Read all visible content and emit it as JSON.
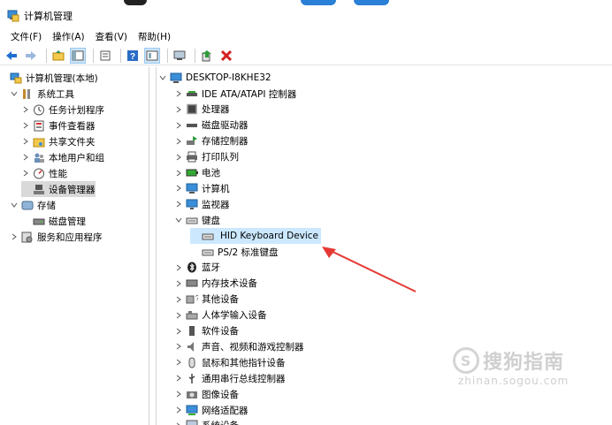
{
  "window": {
    "title": "计算机管理"
  },
  "menubar": [
    "文件(F)",
    "操作(A)",
    "查看(V)",
    "帮助(H)"
  ],
  "left_tree": [
    {
      "label": "计算机管理(本地)",
      "chev": "",
      "icon": "computer-management-icon",
      "level": 0
    },
    {
      "label": "系统工具",
      "chev": "v",
      "icon": "tools-icon",
      "level": 1
    },
    {
      "label": "任务计划程序",
      "chev": ">",
      "icon": "clock-icon",
      "level": 2
    },
    {
      "label": "事件查看器",
      "chev": ">",
      "icon": "event-viewer-icon",
      "level": 2
    },
    {
      "label": "共享文件夹",
      "chev": ">",
      "icon": "shared-folder-icon",
      "level": 2
    },
    {
      "label": "本地用户和组",
      "chev": ">",
      "icon": "users-icon",
      "level": 2
    },
    {
      "label": "性能",
      "chev": ">",
      "icon": "performance-icon",
      "level": 2
    },
    {
      "label": "设备管理器",
      "chev": "",
      "icon": "device-manager-icon",
      "level": 2,
      "selected": true
    },
    {
      "label": "存储",
      "chev": "v",
      "icon": "storage-icon",
      "level": 1
    },
    {
      "label": "磁盘管理",
      "chev": "",
      "icon": "disk-management-icon",
      "level": 2
    },
    {
      "label": "服务和应用程序",
      "chev": ">",
      "icon": "services-icon",
      "level": 1
    }
  ],
  "right_tree": {
    "root": "DESKTOP-I8KHE32",
    "items": [
      {
        "label": "IDE ATA/ATAPI 控制器",
        "chev": ">",
        "icon": "ide-controller-icon",
        "level": 1
      },
      {
        "label": "处理器",
        "chev": ">",
        "icon": "processor-icon",
        "level": 1
      },
      {
        "label": "磁盘驱动器",
        "chev": ">",
        "icon": "disk-drive-icon",
        "level": 1
      },
      {
        "label": "存储控制器",
        "chev": ">",
        "icon": "storage-controller-icon",
        "level": 1
      },
      {
        "label": "打印队列",
        "chev": ">",
        "icon": "printer-icon",
        "level": 1
      },
      {
        "label": "电池",
        "chev": ">",
        "icon": "battery-icon",
        "level": 1
      },
      {
        "label": "计算机",
        "chev": ">",
        "icon": "computer-icon",
        "level": 1
      },
      {
        "label": "监视器",
        "chev": ">",
        "icon": "monitor-icon",
        "level": 1
      },
      {
        "label": "键盘",
        "chev": "v",
        "icon": "keyboard-icon",
        "level": 1
      },
      {
        "label": "HID Keyboard Device",
        "chev": "",
        "icon": "keyboard-icon",
        "level": 2,
        "selected": true
      },
      {
        "label": "PS/2 标准键盘",
        "chev": "",
        "icon": "keyboard-icon",
        "level": 2
      },
      {
        "label": "蓝牙",
        "chev": ">",
        "icon": "bluetooth-icon",
        "level": 1
      },
      {
        "label": "内存技术设备",
        "chev": ">",
        "icon": "memory-device-icon",
        "level": 1
      },
      {
        "label": "其他设备",
        "chev": ">",
        "icon": "other-device-icon",
        "level": 1
      },
      {
        "label": "人体学输入设备",
        "chev": ">",
        "icon": "hid-icon",
        "level": 1
      },
      {
        "label": "软件设备",
        "chev": ">",
        "icon": "software-device-icon",
        "level": 1
      },
      {
        "label": "声音、视频和游戏控制器",
        "chev": ">",
        "icon": "speaker-icon",
        "level": 1
      },
      {
        "label": "鼠标和其他指针设备",
        "chev": ">",
        "icon": "mouse-icon",
        "level": 1
      },
      {
        "label": "通用串行总线控制器",
        "chev": ">",
        "icon": "usb-icon",
        "level": 1
      },
      {
        "label": "图像设备",
        "chev": ">",
        "icon": "camera-icon",
        "level": 1
      },
      {
        "label": "网络适配器",
        "chev": ">",
        "icon": "network-adapter-icon",
        "level": 1
      },
      {
        "label": "系统设备",
        "chev": ">",
        "icon": "system-device-icon",
        "level": 1
      }
    ]
  },
  "watermark": {
    "text": "搜狗指南",
    "url": "zhinan.sogou.com"
  },
  "colors": {
    "selection": "#cce8ff",
    "arrow": "#e53935",
    "accent": "#0078d7"
  }
}
